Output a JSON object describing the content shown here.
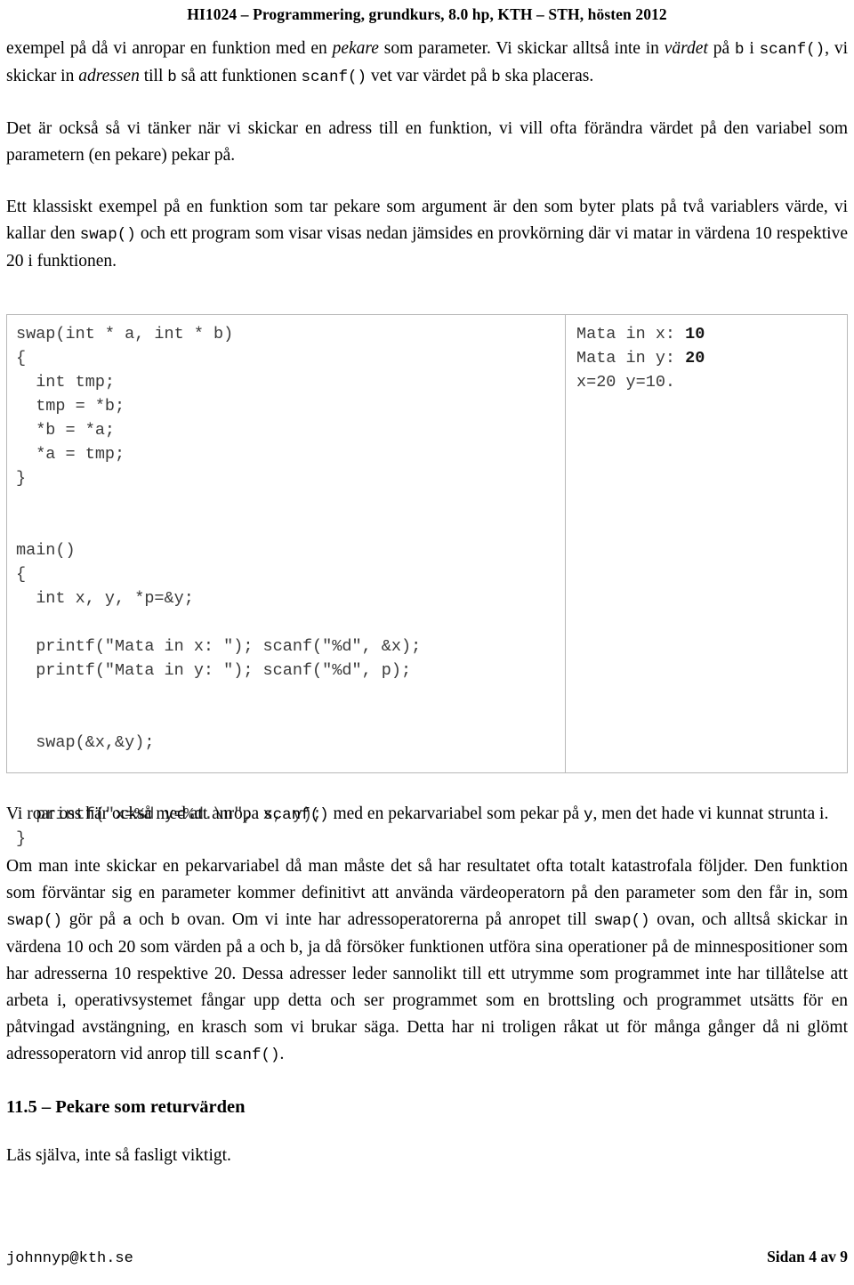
{
  "header": {
    "title": "HI1024 – Programmering, grundkurs, 8.0 hp, KTH – STH, hösten 2012"
  },
  "paragraphs": {
    "p1": {
      "seg1": "exempel på då vi anropar en funktion med en ",
      "em1": "pekare",
      "seg2": " som parameter. Vi skickar alltså inte in ",
      "em2": "värdet",
      "seg3": " på ",
      "code1": "b",
      "seg4": " i ",
      "code2": "scanf()",
      "seg5": ", vi skickar in ",
      "em3": "adressen",
      "seg6": " till ",
      "code3": "b",
      "seg7": " så att funktionen ",
      "code4": "scanf()",
      "seg8": " vet var värdet på ",
      "code5": "b",
      "seg9": " ska placeras."
    },
    "p2": {
      "text": "Det är också så vi tänker när vi skickar en adress till en funktion, vi vill ofta förändra värdet på den variabel som parametern (en pekare) pekar på."
    },
    "p3": {
      "seg1": "Ett klassiskt exempel på en funktion som tar pekare som argument är den som byter plats på två variablers värde, vi kallar den ",
      "code1": "swap()",
      "seg2": " och ett program som visar visas nedan jämsides en provkörning där vi matar in värdena 10 respektive 20 i funktionen."
    },
    "p4": {
      "seg1": "Vi roar oss här också med att anropa ",
      "code1": "scanf()",
      "seg2": " med en pekarvariabel som pekar på ",
      "code2": "y",
      "seg3": ", men det hade vi kunnat strunta i."
    },
    "p5": {
      "seg1": "Om man inte skickar en pekarvariabel då man måste det så har resultatet ofta totalt katastrofala följder. Den funktion som förväntar sig en parameter kommer definitivt att använda värdeoperatorn på den parameter som den får in, som ",
      "code1": "swap()",
      "seg2": " gör på ",
      "code2": "a",
      "seg3": " och ",
      "code3": "b",
      "seg4": " ovan. Om vi inte har adressoperatorerna på anropet till ",
      "code4": "swap()",
      "seg5": " ovan, och alltså skickar in värdena 10 och 20 som värden på a och b, ja då försöker funktionen utföra sina operationer på de minnespositioner som har adresserna 10 respektive 20. Dessa adresser leder sannolikt till ett utrymme som programmet inte har tillåtelse att arbeta i, operativsystemet fångar upp detta och ser programmet som en brottsling och programmet utsätts för en påtvingad avstängning, en krasch som vi brukar säga. Detta har ni troligen råkat ut för många gånger då ni glömt adressoperatorn vid anrop till ",
      "code5": "scanf()",
      "seg6": "."
    }
  },
  "code_panel": {
    "code": "swap(int * a, int * b)\n{\n  int tmp;\n  tmp = *b;\n  *b = *a;\n  *a = tmp;\n}\n\n\nmain()\n{\n  int x, y, *p=&y;\n\n  printf(\"Mata in x: \"); scanf(\"%d\", &x);\n  printf(\"Mata in y: \"); scanf(\"%d\", p);\n\n\n  swap(&x,&y);\n\n\n  printf(\"x=%d y=%d.\\n\", x, y);\n}"
  },
  "output_panel": {
    "line1_prompt": "Mata in x: ",
    "line1_input": "10",
    "line2_prompt": "Mata in y: ",
    "line2_input": "20",
    "line3": "x=20 y=10."
  },
  "section": {
    "heading": "11.5 – Pekare som returvärden",
    "body": "Läs själva, inte så fasligt viktigt."
  },
  "footer": {
    "email": "johnnyp@kth.se",
    "page": "Sidan 4 av 9"
  }
}
